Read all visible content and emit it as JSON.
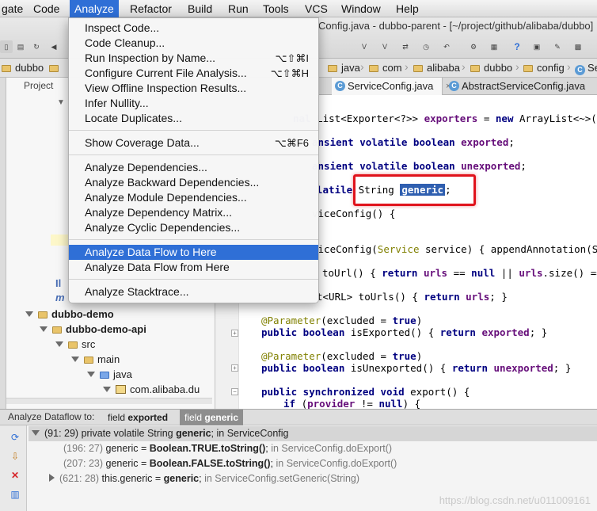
{
  "menubar": {
    "items": [
      "gate",
      "Code",
      "Analyze",
      "Refactor",
      "Build",
      "Run",
      "Tools",
      "VCS",
      "Window",
      "Help"
    ],
    "active": "Analyze"
  },
  "window": {
    "title": "Config.java - dubbo-parent - [~/project/github/alibaba/dubbo]"
  },
  "breadcrumbs": {
    "left": [
      "dubbo"
    ],
    "right": [
      "java",
      "com",
      "alibaba",
      "dubbo",
      "config",
      "Se"
    ]
  },
  "project_panel": {
    "tab_label": "Project",
    "tree": [
      {
        "label": "dubbo-demo",
        "depth": 0
      },
      {
        "label": "dubbo-demo-api",
        "depth": 1
      },
      {
        "label": "src",
        "depth": 2
      },
      {
        "label": "main",
        "depth": 3
      },
      {
        "label": "java",
        "depth": 4
      },
      {
        "label": "com.alibaba.du",
        "depth": 5
      }
    ]
  },
  "editor": {
    "tabs": [
      {
        "label": "ServiceConfig.java",
        "active": true
      },
      {
        "label": "AbstractServiceConfig.java",
        "active": false
      }
    ]
  },
  "analyze_menu": {
    "items": [
      {
        "label": "Inspect Code...",
        "shortcut": ""
      },
      {
        "label": "Code Cleanup...",
        "shortcut": ""
      },
      {
        "label": "Run Inspection by Name...",
        "shortcut": "⌥⇧⌘I"
      },
      {
        "label": "Configure Current File Analysis...",
        "shortcut": "⌥⇧⌘H"
      },
      {
        "label": "View Offline Inspection Results...",
        "shortcut": ""
      },
      {
        "label": "Infer Nullity...",
        "shortcut": ""
      },
      {
        "label": "Locate Duplicates...",
        "shortcut": ""
      },
      {
        "label": "Show Coverage Data...",
        "shortcut": "⌥⌘F6"
      },
      {
        "label": "Analyze Dependencies...",
        "shortcut": ""
      },
      {
        "label": "Analyze Backward Dependencies...",
        "shortcut": ""
      },
      {
        "label": "Analyze Module Dependencies...",
        "shortcut": ""
      },
      {
        "label": "Analyze Dependency Matrix...",
        "shortcut": ""
      },
      {
        "label": "Analyze Cyclic Dependencies...",
        "shortcut": ""
      },
      {
        "label": "Analyze Data Flow to Here",
        "shortcut": ""
      },
      {
        "label": "Analyze Data Flow from Here",
        "shortcut": ""
      },
      {
        "label": "Analyze Stacktrace...",
        "shortcut": ""
      }
    ],
    "highlighted": "Analyze Data Flow to Here"
  },
  "dataflow": {
    "title": "Analyze Dataflow to:",
    "tabs": [
      {
        "prefix": "field ",
        "name": "exported",
        "active": false
      },
      {
        "prefix": "field ",
        "name": "generic",
        "active": true
      }
    ],
    "root": {
      "loc": "(91: 29)",
      "pre": " private volatile String ",
      "name": "generic",
      "post": "; in ServiceConfig"
    },
    "children": [
      {
        "loc": "(196: 27)",
        "pre": " generic = ",
        "bold": "Boolean.TRUE.toString()",
        "post": ";",
        "where": " in ServiceConfig.doExport()"
      },
      {
        "loc": "(207: 23)",
        "pre": " generic = ",
        "bold": "Boolean.FALSE.toString()",
        "post": ";",
        "where": " in ServiceConfig.doExport()"
      },
      {
        "loc": "(621: 28)",
        "pre": " this.generic = ",
        "bold": "generic",
        "post": ";",
        "where": " in ServiceConfig.setGeneric(String)"
      }
    ]
  },
  "watermark": "https://blog.csdn.net/u011009161"
}
